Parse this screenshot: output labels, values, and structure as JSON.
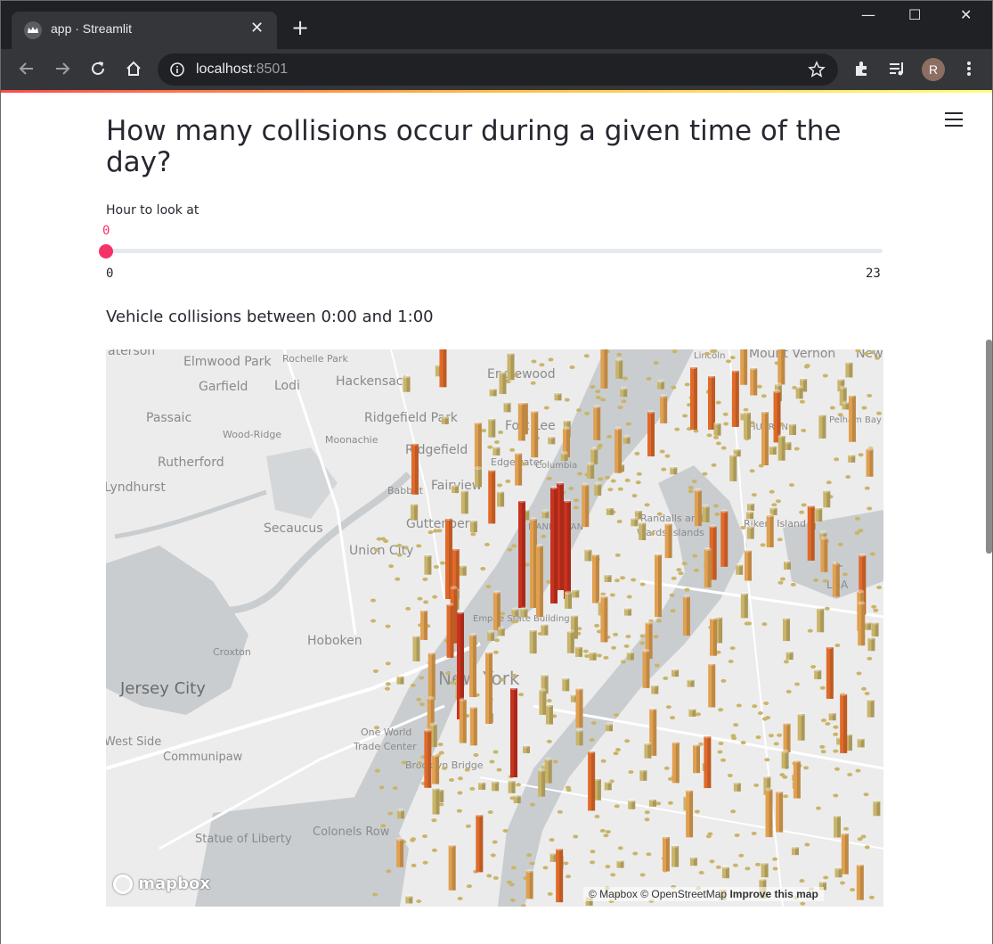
{
  "browser": {
    "tab_title": "app · Streamlit",
    "tab_close": "✕",
    "new_tab": "+",
    "url_host": "localhost",
    "url_port": ":8501",
    "profile_initial": "R",
    "window_controls": {
      "minimize": "—",
      "maximize": "☐",
      "close": "✕"
    }
  },
  "app": {
    "menu_icon": "hamburger-menu-icon",
    "title": "How many collisions occur during a given time of the day?",
    "slider": {
      "label": "Hour to look at",
      "value": "0",
      "min": "0",
      "max": "23",
      "fill_fraction": 0
    },
    "subtitle": "Vehicle collisions between 0:00 and 1:00"
  },
  "map": {
    "colors": {
      "low": "#c9b46a",
      "mid": "#e0a050",
      "high": "#e06a2a",
      "peak": "#c8321e",
      "water": "#c9cdd0",
      "land": "#ececec"
    },
    "place_labels": [
      "aterson",
      "Elmwood Park",
      "Rochelle Park",
      "Englewood",
      "Lincoln",
      "Mount Vernon",
      "New",
      "Garfield",
      "Lodi",
      "Hackensack",
      "Passaic",
      "Ridgefield Park",
      "Fort Lee",
      "Pelham Bay",
      "Wood-Ridge",
      "Moonachie",
      "HUBRON",
      "Rutherford",
      "Ridgefield",
      "Edgewater",
      "Lyndhurst",
      "Babbitt",
      "Fairview",
      "Columbia",
      "Randalls and",
      "Wards Islands",
      "Rikers Island",
      "Secaucus",
      "Guttenberg",
      "MANHATTAN",
      "Union City",
      "Hoboken",
      "Empire State Building",
      "Croxton",
      "Jersey City",
      "New York",
      "One World",
      "Trade Center",
      "West Side",
      "Brooklyn Bridge",
      "Communipaw",
      "Statue of Liberty",
      "Colonels Row",
      "LGA"
    ],
    "logo_text": "mapbox",
    "attribution_text": "© Mapbox © OpenStreetMap",
    "attribution_link": "Improve this map"
  }
}
